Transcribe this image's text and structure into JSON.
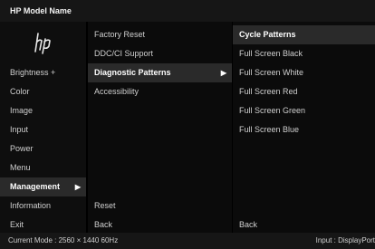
{
  "header": {
    "title": "HP Model Name"
  },
  "brand": {
    "logo": "hp"
  },
  "main_menu": {
    "items": [
      {
        "label": "Brightness +"
      },
      {
        "label": "Color"
      },
      {
        "label": "Image"
      },
      {
        "label": "Input"
      },
      {
        "label": "Power"
      },
      {
        "label": "Menu"
      },
      {
        "label": "Management"
      },
      {
        "label": "Information"
      },
      {
        "label": "Exit"
      }
    ],
    "selected": "Management"
  },
  "submenu": {
    "items": [
      {
        "label": "Factory Reset"
      },
      {
        "label": "DDC/CI Support"
      },
      {
        "label": "Diagnostic Patterns"
      },
      {
        "label": "Accessibility"
      }
    ],
    "selected": "Diagnostic Patterns",
    "reset_label": "Reset",
    "back_label": "Back"
  },
  "patterns_menu": {
    "items": [
      {
        "label": "Cycle Patterns"
      },
      {
        "label": "Full Screen Black"
      },
      {
        "label": "Full Screen White"
      },
      {
        "label": "Full Screen Red"
      },
      {
        "label": "Full Screen Green"
      },
      {
        "label": "Full Screen Blue"
      }
    ],
    "selected": "Cycle Patterns",
    "back_label": "Back"
  },
  "status": {
    "current_mode": "Current Mode : 2560 × 1440  60Hz",
    "input": "Input : DisplayPort"
  },
  "arrow_glyph": "▶",
  "colors": {
    "background": "#000000",
    "bar": "#161616",
    "selected": "#2a2a2a",
    "text": "#cfcfcf"
  }
}
